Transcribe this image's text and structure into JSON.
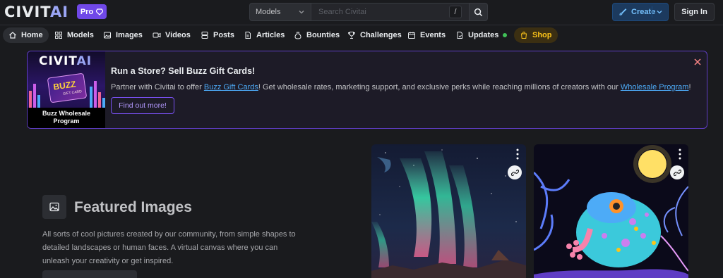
{
  "header": {
    "logo_main": "CIVIT",
    "logo_accent": "AI",
    "pro_label": "Pro",
    "search": {
      "selected_category": "Models",
      "placeholder": "Search Civitai",
      "shortcut_key": "/"
    },
    "create_label": "Create",
    "signin_label": "Sign In"
  },
  "nav": {
    "items": [
      {
        "label": "Home",
        "icon": "home-icon"
      },
      {
        "label": "Models",
        "icon": "grid-icon"
      },
      {
        "label": "Images",
        "icon": "image-icon"
      },
      {
        "label": "Videos",
        "icon": "video-icon"
      },
      {
        "label": "Posts",
        "icon": "posts-icon"
      },
      {
        "label": "Articles",
        "icon": "article-icon"
      },
      {
        "label": "Bounties",
        "icon": "moneybag-icon"
      },
      {
        "label": "Challenges",
        "icon": "trophy-icon"
      },
      {
        "label": "Events",
        "icon": "calendar-icon"
      },
      {
        "label": "Updates",
        "icon": "updates-icon"
      },
      {
        "label": "Shop",
        "icon": "shopping-bag-icon"
      }
    ]
  },
  "banner": {
    "image_logo_main": "CIVIT",
    "image_logo_accent": "AI",
    "image_card_title": "BUZZ",
    "image_card_sub": "GIFT CARD",
    "image_caption_line1": "Buzz Wholesale",
    "image_caption_line2": "Program",
    "title": "Run a Store? Sell Buzz Gift Cards!",
    "text_before": "Partner with Civitai to offer ",
    "link1": "Buzz Gift Cards",
    "text_middle": "! Get wholesale rates, marketing support, and exclusive perks while reaching millions of creators with our ",
    "link2": "Wholesale Program",
    "text_after": "!",
    "button_label": "Find out more!"
  },
  "featured": {
    "title": "Featured Images",
    "description": "All sorts of cool pictures created by our community, from simple shapes to detailed landscapes or human faces. A virtual canvas where you can unleash your creativity or get inspired."
  },
  "colors": {
    "background": "#1a1b1e",
    "accent_purple": "#7048e8",
    "link_blue": "#4dabf7",
    "shop_yellow": "#fcc419",
    "updates_dot": "#40c057"
  }
}
